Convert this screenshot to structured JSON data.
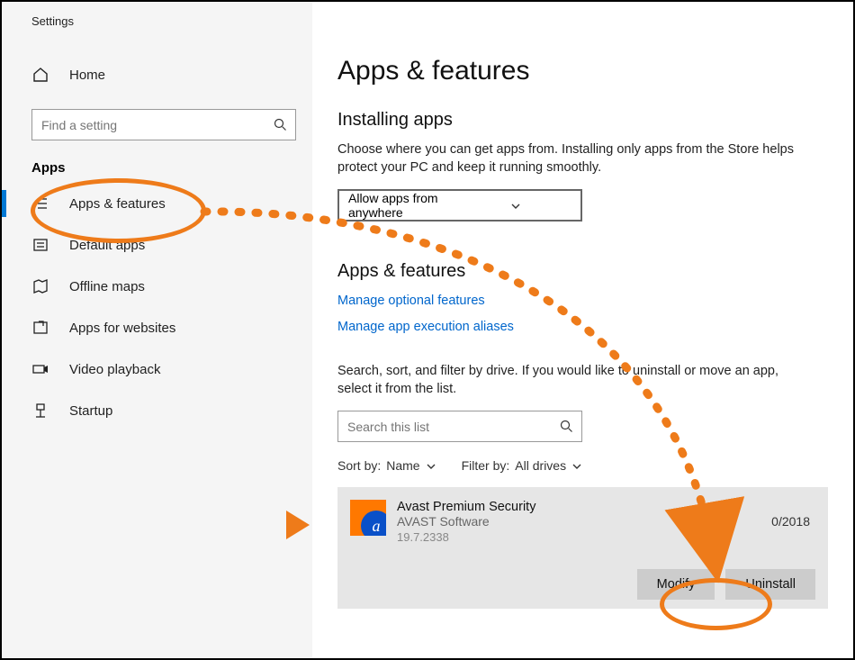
{
  "window": {
    "title": "Settings"
  },
  "sidebar": {
    "home_label": "Home",
    "search_placeholder": "Find a setting",
    "section": "Apps",
    "items": [
      {
        "label": "Apps & features"
      },
      {
        "label": "Default apps"
      },
      {
        "label": "Offline maps"
      },
      {
        "label": "Apps for websites"
      },
      {
        "label": "Video playback"
      },
      {
        "label": "Startup"
      }
    ]
  },
  "main": {
    "page_title": "Apps & features",
    "install_title": "Installing apps",
    "install_desc": "Choose where you can get apps from. Installing only apps from the Store helps protect your PC and keep it running smoothly.",
    "install_select": "Allow apps from anywhere",
    "section2_title": "Apps & features",
    "link_optional": "Manage optional features",
    "link_aliases": "Manage app execution aliases",
    "filter_desc": "Search, sort, and filter by drive. If you would like to uninstall or move an app, select it from the list.",
    "search_placeholder": "Search this list",
    "sort_label": "Sort by:",
    "sort_value": "Name",
    "filter_label": "Filter by:",
    "filter_value": "All drives",
    "app": {
      "name": "Avast Premium Security",
      "publisher": "AVAST Software",
      "version": "19.7.2338",
      "date": "0/2018",
      "modify_label": "Modify",
      "uninstall_label": "Uninstall"
    }
  }
}
